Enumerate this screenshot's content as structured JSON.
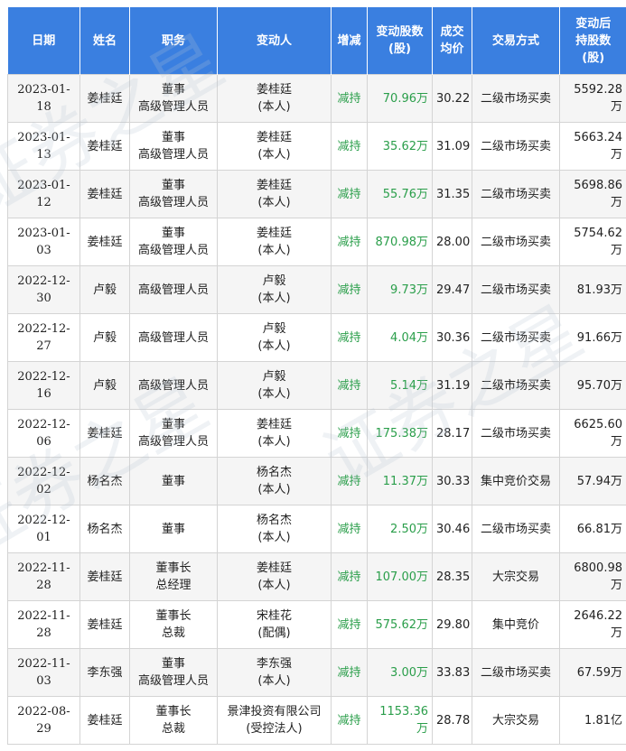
{
  "headers": {
    "date": "日期",
    "name": "姓名",
    "position": "职务",
    "changer": "变动人",
    "direction": "增减",
    "shares_l1": "变动股数",
    "shares_l2": "(股)",
    "price_l1": "成交",
    "price_l2": "均价",
    "method": "交易方式",
    "after_l1": "变动后",
    "after_l2": "持股数",
    "after_l3": "(股)"
  },
  "rows": [
    {
      "date": "2023-01-18",
      "name": "姜桂廷",
      "pos1": "董事",
      "pos2": "高级管理人员",
      "chg1": "姜桂廷",
      "chg2": "(本人)",
      "dir": "减持",
      "shares": "70.96万",
      "price": "30.22",
      "method": "二级市场买卖",
      "after": "5592.28万"
    },
    {
      "date": "2023-01-13",
      "name": "姜桂廷",
      "pos1": "董事",
      "pos2": "高级管理人员",
      "chg1": "姜桂廷",
      "chg2": "(本人)",
      "dir": "减持",
      "shares": "35.62万",
      "price": "31.09",
      "method": "二级市场买卖",
      "after": "5663.24万"
    },
    {
      "date": "2023-01-12",
      "name": "姜桂廷",
      "pos1": "董事",
      "pos2": "高级管理人员",
      "chg1": "姜桂廷",
      "chg2": "(本人)",
      "dir": "减持",
      "shares": "55.76万",
      "price": "31.35",
      "method": "二级市场买卖",
      "after": "5698.86万"
    },
    {
      "date": "2023-01-03",
      "name": "姜桂廷",
      "pos1": "董事",
      "pos2": "高级管理人员",
      "chg1": "姜桂廷",
      "chg2": "(本人)",
      "dir": "减持",
      "shares": "870.98万",
      "price": "28.00",
      "method": "二级市场买卖",
      "after": "5754.62万"
    },
    {
      "date": "2022-12-30",
      "name": "卢毅",
      "pos1": "高级管理人员",
      "pos2": "",
      "chg1": "卢毅",
      "chg2": "(本人)",
      "dir": "减持",
      "shares": "9.73万",
      "price": "29.47",
      "method": "二级市场买卖",
      "after": "81.93万"
    },
    {
      "date": "2022-12-27",
      "name": "卢毅",
      "pos1": "高级管理人员",
      "pos2": "",
      "chg1": "卢毅",
      "chg2": "(本人)",
      "dir": "减持",
      "shares": "4.04万",
      "price": "30.36",
      "method": "二级市场买卖",
      "after": "91.66万"
    },
    {
      "date": "2022-12-16",
      "name": "卢毅",
      "pos1": "高级管理人员",
      "pos2": "",
      "chg1": "卢毅",
      "chg2": "(本人)",
      "dir": "减持",
      "shares": "5.14万",
      "price": "31.19",
      "method": "二级市场买卖",
      "after": "95.70万"
    },
    {
      "date": "2022-12-06",
      "name": "姜桂廷",
      "pos1": "董事",
      "pos2": "高级管理人员",
      "chg1": "姜桂廷",
      "chg2": "(本人)",
      "dir": "减持",
      "shares": "175.38万",
      "price": "28.17",
      "method": "二级市场买卖",
      "after": "6625.60万"
    },
    {
      "date": "2022-12-02",
      "name": "杨名杰",
      "pos1": "董事",
      "pos2": "",
      "chg1": "杨名杰",
      "chg2": "(本人)",
      "dir": "减持",
      "shares": "11.37万",
      "price": "30.33",
      "method": "集中竞价交易",
      "after": "57.94万"
    },
    {
      "date": "2022-12-01",
      "name": "杨名杰",
      "pos1": "董事",
      "pos2": "",
      "chg1": "杨名杰",
      "chg2": "(本人)",
      "dir": "减持",
      "shares": "2.50万",
      "price": "30.46",
      "method": "二级市场买卖",
      "after": "66.81万"
    },
    {
      "date": "2022-11-28",
      "name": "姜桂廷",
      "pos1": "董事长",
      "pos2": "总经理",
      "chg1": "姜桂廷",
      "chg2": "(本人)",
      "dir": "减持",
      "shares": "107.00万",
      "price": "28.35",
      "method": "大宗交易",
      "after": "6800.98万"
    },
    {
      "date": "2022-11-28",
      "name": "姜桂廷",
      "pos1": "董事长",
      "pos2": "总裁",
      "chg1": "宋桂花",
      "chg2": "(配偶)",
      "dir": "减持",
      "shares": "575.62万",
      "price": "29.80",
      "method": "集中竞价",
      "after": "2646.22万"
    },
    {
      "date": "2022-11-03",
      "name": "李东强",
      "pos1": "董事",
      "pos2": "高级管理人员",
      "chg1": "李东强",
      "chg2": "(本人)",
      "dir": "减持",
      "shares": "3.00万",
      "price": "33.83",
      "method": "二级市场买卖",
      "after": "67.59万"
    },
    {
      "date": "2022-08-29",
      "name": "姜桂廷",
      "pos1": "董事长",
      "pos2": "总裁",
      "chg1": "景津投资有限公司",
      "chg2": "(受控法人)",
      "dir": "减持",
      "shares": "1153.36万",
      "price": "28.78",
      "method": "大宗交易",
      "after": "1.81亿"
    }
  ],
  "watermark": "证券之星"
}
